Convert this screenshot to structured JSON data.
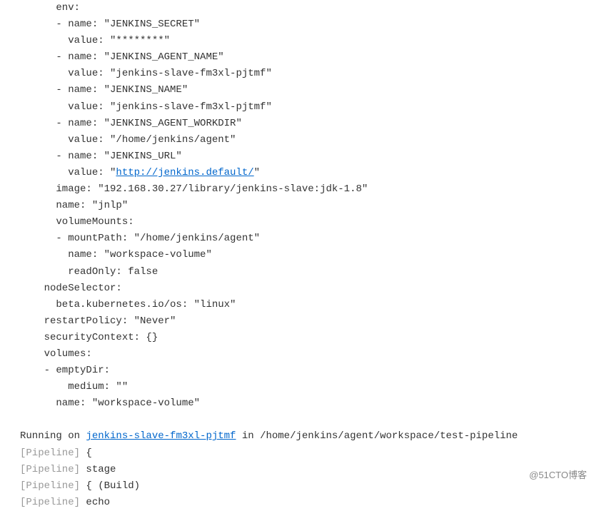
{
  "lines": [
    {
      "indent": 3,
      "text": "env:"
    },
    {
      "indent": 3,
      "text": "- name: \"JENKINS_SECRET\""
    },
    {
      "indent": 4,
      "text": "value: \"********\""
    },
    {
      "indent": 3,
      "text": "- name: \"JENKINS_AGENT_NAME\""
    },
    {
      "indent": 4,
      "text": "value: \"jenkins-slave-fm3xl-pjtmf\""
    },
    {
      "indent": 3,
      "text": "- name: \"JENKINS_NAME\""
    },
    {
      "indent": 4,
      "text": "value: \"jenkins-slave-fm3xl-pjtmf\""
    },
    {
      "indent": 3,
      "text": "- name: \"JENKINS_AGENT_WORKDIR\""
    },
    {
      "indent": 4,
      "text": "value: \"/home/jenkins/agent\""
    },
    {
      "indent": 3,
      "text": "- name: \"JENKINS_URL\""
    },
    {
      "indent": 4,
      "prefix": "value: \"",
      "link": "http://jenkins.default/",
      "suffix": "\""
    },
    {
      "indent": 3,
      "text": "image: \"192.168.30.27/library/jenkins-slave:jdk-1.8\""
    },
    {
      "indent": 3,
      "text": "name: \"jnlp\""
    },
    {
      "indent": 3,
      "text": "volumeMounts:"
    },
    {
      "indent": 3,
      "text": "- mountPath: \"/home/jenkins/agent\""
    },
    {
      "indent": 4,
      "text": "name: \"workspace-volume\""
    },
    {
      "indent": 4,
      "text": "readOnly: false"
    },
    {
      "indent": 2,
      "text": "nodeSelector:"
    },
    {
      "indent": 3,
      "text": "beta.kubernetes.io/os: \"linux\""
    },
    {
      "indent": 2,
      "text": "restartPolicy: \"Never\""
    },
    {
      "indent": 2,
      "text": "securityContext: {}"
    },
    {
      "indent": 2,
      "text": "volumes:"
    },
    {
      "indent": 2,
      "text": "- emptyDir:"
    },
    {
      "indent": 4,
      "text": "medium: \"\""
    },
    {
      "indent": 3,
      "text": "name: \"workspace-volume\""
    },
    {
      "indent": 0,
      "text": ""
    },
    {
      "indent": 0,
      "prefix": "Running on ",
      "link": "jenkins-slave-fm3xl-pjtmf",
      "suffix": " in /home/jenkins/agent/workspace/test-pipeline"
    },
    {
      "indent": 0,
      "pipeline": "[Pipeline] ",
      "text": "{"
    },
    {
      "indent": 0,
      "pipeline": "[Pipeline] ",
      "text": "stage"
    },
    {
      "indent": 0,
      "pipeline": "[Pipeline] ",
      "text": "{ (Build)"
    },
    {
      "indent": 0,
      "pipeline": "[Pipeline] ",
      "text": "echo"
    }
  ],
  "watermark": "@51CTO博客"
}
